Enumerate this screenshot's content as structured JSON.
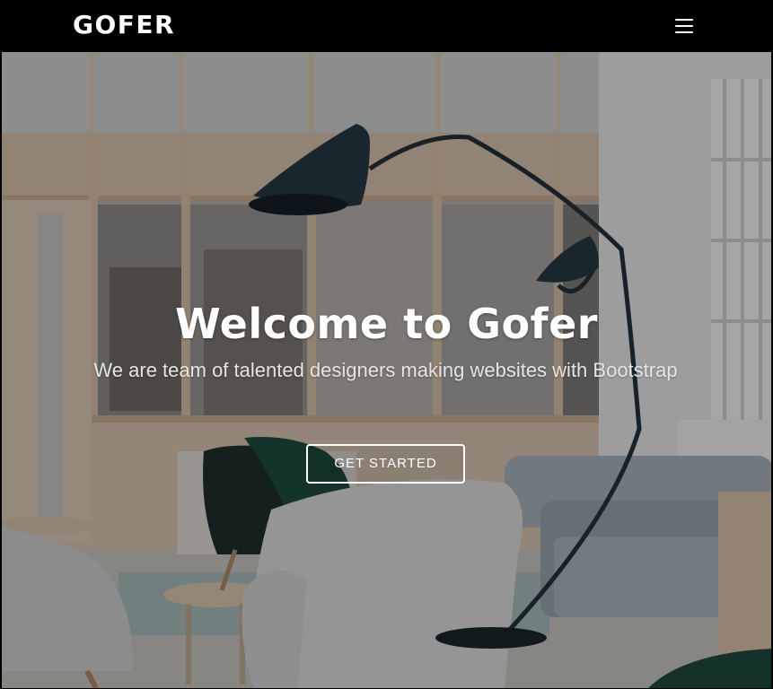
{
  "navbar": {
    "brand": "GOFER",
    "menu_icon": "hamburger-menu-icon"
  },
  "hero": {
    "title": "Welcome to Gofer",
    "subtitle": "We are team of talented designers making websites with Bootstrap",
    "cta_label": "GET STARTED",
    "background_image": "office-lounge-photo"
  },
  "colors": {
    "navbar_bg": "#000000",
    "text": "#ffffff"
  }
}
